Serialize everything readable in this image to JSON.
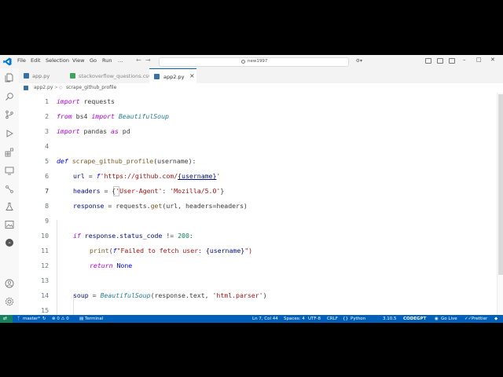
{
  "menu": [
    "File",
    "Edit",
    "Selection",
    "View",
    "Go",
    "Run",
    "…"
  ],
  "search": {
    "text": "new1997"
  },
  "tabs": [
    {
      "label": "app.py",
      "active": false
    },
    {
      "label": "stackoverflow_questions.csv",
      "active": false
    },
    {
      "label": "app2.py",
      "active": true
    }
  ],
  "breadcrumb": {
    "file": "app2.py",
    "symbol": "scrape_github_profile",
    "sep": ">"
  },
  "line_numbers": [
    "1",
    "2",
    "3",
    "4",
    "5",
    "6",
    "7",
    "8",
    "9",
    "10",
    "11",
    "12",
    "13",
    "14",
    "15"
  ],
  "code": {
    "l1_kw": "import",
    "l1_rest": " requests",
    "l2_kw": "from",
    "l2_mod": " bs4 ",
    "l2_kw2": "import",
    "l2_cls": " BeautifulSoup",
    "l3_kw": "import",
    "l3_mod": " pandas ",
    "l3_kw2": "as",
    "l3_alias": " pd",
    "l5_kw": "def",
    "l5_fn": " scrape_github_profile",
    "l5_rest": "(username):",
    "l6_var": "url",
    "l6_eq": " = ",
    "l6_f": "f",
    "l6_str": "'https://github.com/",
    "l6_arg": "{username}",
    "l6_end": "'",
    "l7_var": "headers",
    "l7_eq": " = {",
    "l7_k": "'User-Agent'",
    "l7_colon": ": ",
    "l7_v": "'Mozilla/5.0'",
    "l7_end": "}",
    "l8_var": "response",
    "l8_eq": " = requests.",
    "l8_fn": "get",
    "l8_rest": "(url, headers=headers)",
    "l10_kw": "if",
    "l10_rest": " response.status_code ",
    "l10_op": "!=",
    "l10_num": " 200",
    "l10_end": ":",
    "l11_fn": "print",
    "l11_p": "(",
    "l11_f": "f",
    "l11_str": "\"Failed to fetch user: ",
    "l11_arg": "{username}",
    "l11_end": "\")",
    "l12_kw": "return",
    "l12_rest": " None",
    "l14_var": "soup",
    "l14_eq": " = ",
    "l14_cls": "BeautifulSoup",
    "l14_rest": "(response.text, ",
    "l14_str": "'html.parser'",
    "l14_end": ")"
  },
  "status": {
    "branch": "master*",
    "problems": "⊗ 0 ⚠ 0",
    "terminal": "Terminal",
    "position": "Ln 7, Col 44",
    "spaces": "Spaces: 4",
    "encoding": "UTF-8",
    "eol": "CRLF",
    "language": "Python",
    "version": "3.10.5",
    "codegpt": "CODEGPT",
    "golive": "Go Live",
    "prettier": "Prettier"
  },
  "colors": {
    "accent": "#005fb8",
    "remote": "#16825d",
    "keyword": "#af00db",
    "string": "#a31515"
  }
}
